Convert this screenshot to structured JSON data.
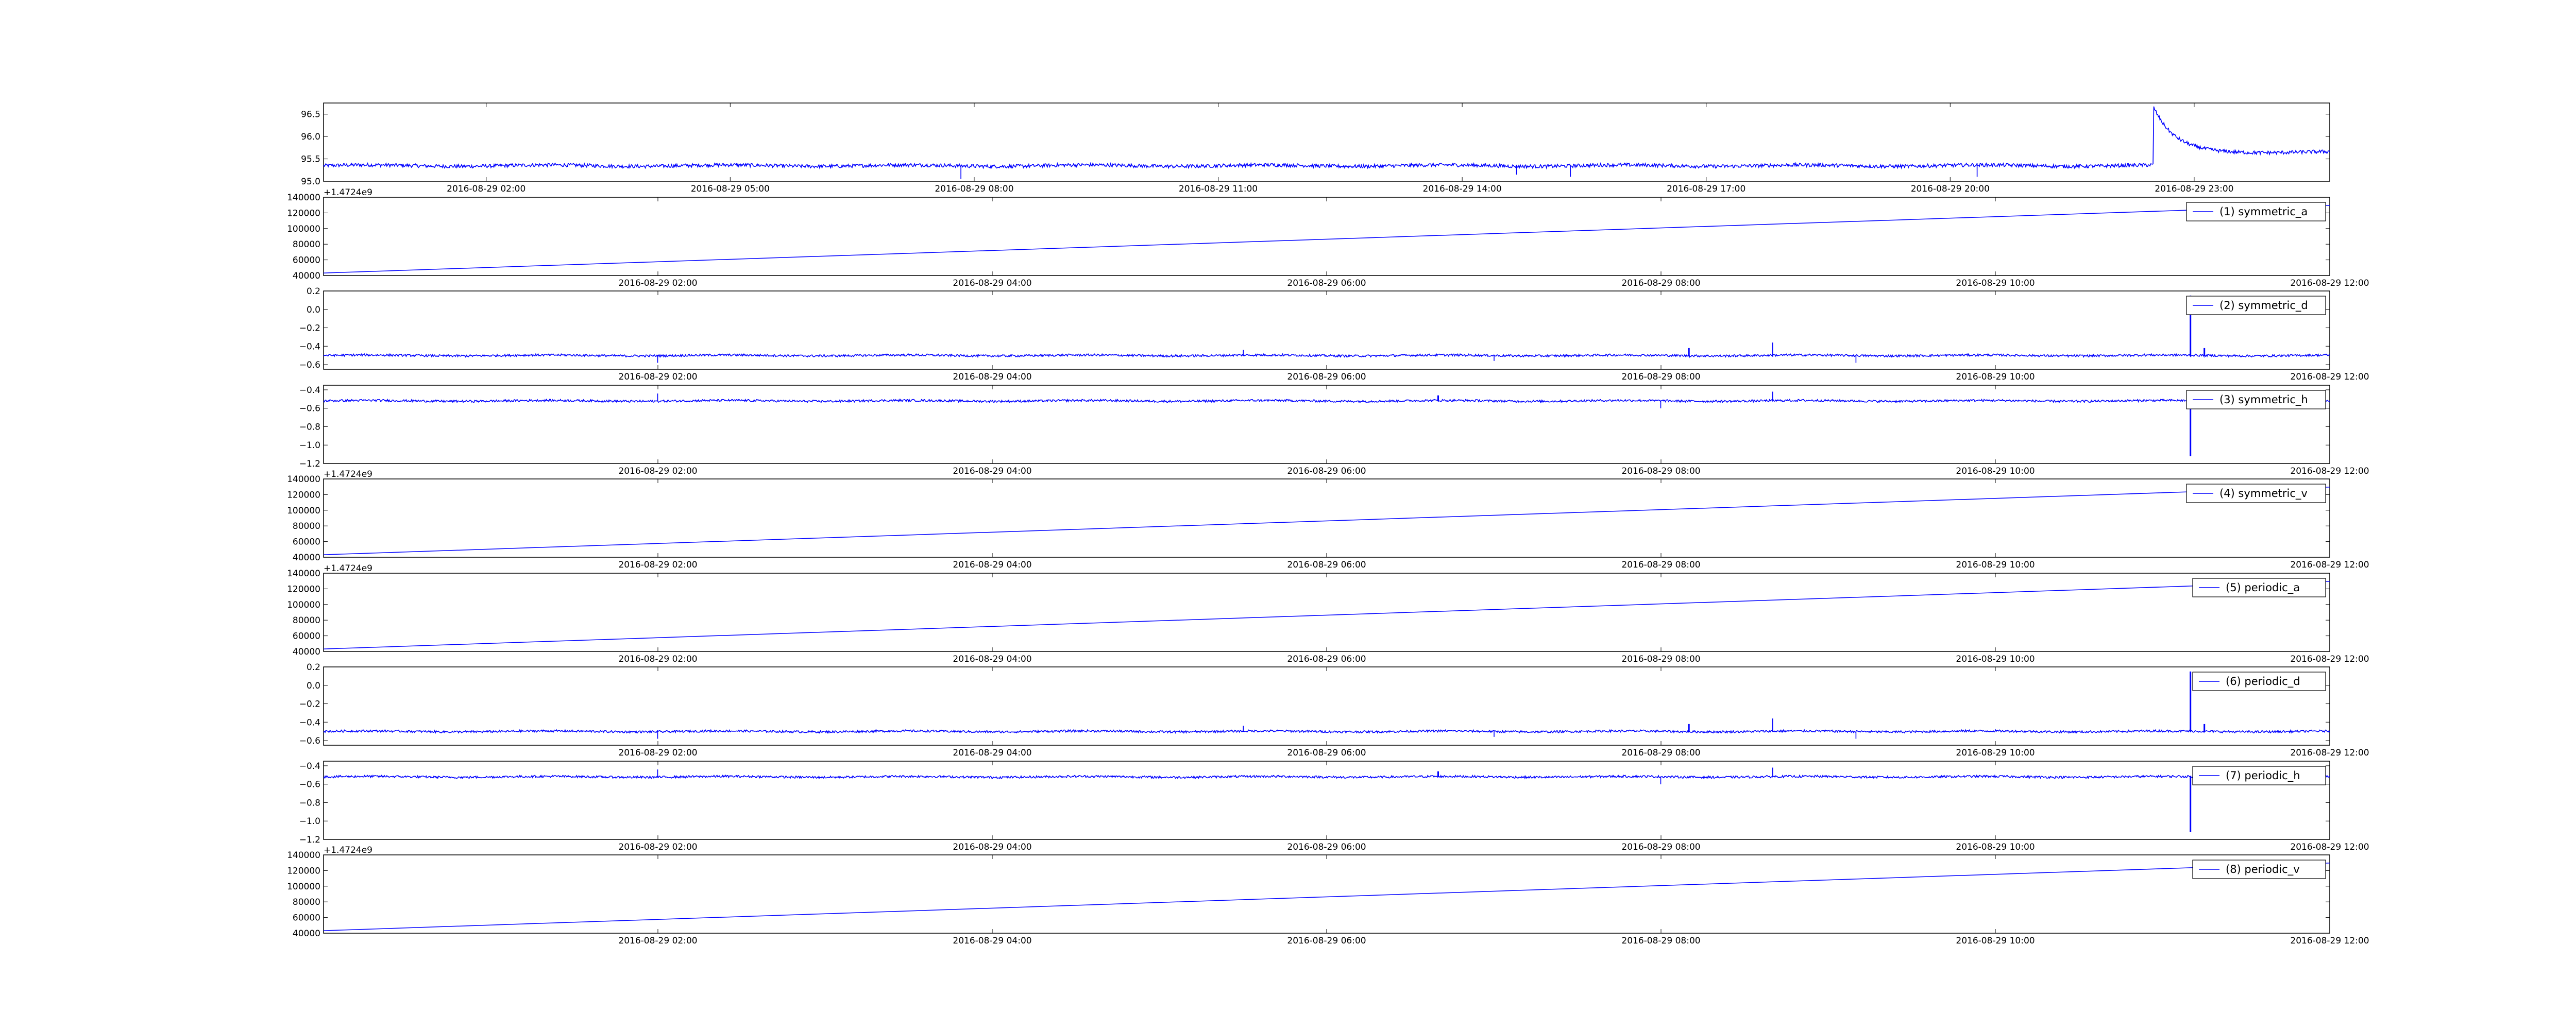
{
  "colors": {
    "series": "#0000ff",
    "axes": "#000000",
    "background": "#ffffff"
  },
  "chart_data": [
    {
      "type": "line",
      "title": "",
      "xlabel": "",
      "ylabel": "",
      "legend": "",
      "offset_label": "",
      "x_range": [
        "2016-08-29 00:00",
        "2016-08-30 00:40"
      ],
      "xticks": [
        "2016-08-29 02:00",
        "2016-08-29 05:00",
        "2016-08-29 08:00",
        "2016-08-29 11:00",
        "2016-08-29 14:00",
        "2016-08-29 17:00",
        "2016-08-29 20:00",
        "2016-08-29 23:00"
      ],
      "ylim": [
        95.0,
        96.75
      ],
      "yticks": [
        "95.0",
        "95.5",
        "96.0",
        "96.5"
      ],
      "pattern": "noise",
      "baseline": 95.35,
      "noise": 0.04,
      "shift_at": "2016-08-29 22:30",
      "shift_level": 95.65,
      "shift_peak": 96.65,
      "spikes": [
        [
          "2016-08-29 07:50",
          95.05
        ],
        [
          "2016-08-29 14:40",
          95.15
        ],
        [
          "2016-08-29 15:20",
          95.1
        ],
        [
          "2016-08-29 20:20",
          95.1
        ]
      ]
    },
    {
      "type": "line",
      "legend": "(1) symmetric_a",
      "offset_label": "+1.4724e9",
      "legend_position": "top-right",
      "x_range": [
        "2016-08-29 00:00",
        "2016-08-29 12:00"
      ],
      "xticks": [
        "2016-08-29 02:00",
        "2016-08-29 04:00",
        "2016-08-29 06:00",
        "2016-08-29 08:00",
        "2016-08-29 10:00",
        "2016-08-29 12:00"
      ],
      "ylim": [
        40000,
        140000
      ],
      "yticks": [
        "40000",
        "60000",
        "80000",
        "100000",
        "120000",
        "140000"
      ],
      "pattern": "linear",
      "x": [
        "2016-08-29 00:00",
        "2016-08-29 12:00"
      ],
      "y": [
        43200,
        129600
      ]
    },
    {
      "type": "line",
      "legend": "(2) symmetric_d",
      "offset_label": "",
      "legend_position": "top-right",
      "x_range": [
        "2016-08-29 00:00",
        "2016-08-29 12:00"
      ],
      "xticks": [
        "2016-08-29 02:00",
        "2016-08-29 04:00",
        "2016-08-29 06:00",
        "2016-08-29 08:00",
        "2016-08-29 10:00",
        "2016-08-29 12:00"
      ],
      "ylim": [
        -0.65,
        0.2
      ],
      "yticks": [
        "−0.6",
        "−0.4",
        "−0.2",
        "0.0",
        "0.2"
      ],
      "pattern": "noise",
      "baseline": -0.5,
      "noise": 0.012,
      "spikes": [
        [
          "2016-08-29 02:00",
          -0.58
        ],
        [
          "2016-08-29 05:30",
          -0.44
        ],
        [
          "2016-08-29 07:00",
          -0.56
        ],
        [
          "2016-08-29 08:10",
          -0.42
        ],
        [
          "2016-08-29 08:40",
          -0.36
        ],
        [
          "2016-08-29 09:10",
          -0.58
        ],
        [
          "2016-08-29 11:10",
          0.15
        ],
        [
          "2016-08-29 11:15",
          -0.42
        ]
      ]
    },
    {
      "type": "line",
      "legend": "(3) symmetric_h",
      "offset_label": "",
      "legend_position": "top-right",
      "x_range": [
        "2016-08-29 00:00",
        "2016-08-29 12:00"
      ],
      "xticks": [
        "2016-08-29 02:00",
        "2016-08-29 04:00",
        "2016-08-29 06:00",
        "2016-08-29 08:00",
        "2016-08-29 10:00",
        "2016-08-29 12:00"
      ],
      "ylim": [
        -1.2,
        -0.35
      ],
      "yticks": [
        "−1.2",
        "−1.0",
        "−0.8",
        "−0.6",
        "−0.4"
      ],
      "pattern": "noise",
      "baseline": -0.52,
      "noise": 0.012,
      "spikes": [
        [
          "2016-08-29 02:00",
          -0.44
        ],
        [
          "2016-08-29 06:40",
          -0.46
        ],
        [
          "2016-08-29 08:00",
          -0.6
        ],
        [
          "2016-08-29 08:40",
          -0.42
        ],
        [
          "2016-08-29 11:10",
          -1.12
        ],
        [
          "2016-08-29 11:15",
          -0.46
        ]
      ]
    },
    {
      "type": "line",
      "legend": "(4) symmetric_v",
      "offset_label": "+1.4724e9",
      "legend_position": "top-right",
      "x_range": [
        "2016-08-29 00:00",
        "2016-08-29 12:00"
      ],
      "xticks": [
        "2016-08-29 02:00",
        "2016-08-29 04:00",
        "2016-08-29 06:00",
        "2016-08-29 08:00",
        "2016-08-29 10:00",
        "2016-08-29 12:00"
      ],
      "ylim": [
        40000,
        140000
      ],
      "yticks": [
        "40000",
        "60000",
        "80000",
        "100000",
        "120000",
        "140000"
      ],
      "pattern": "linear",
      "x": [
        "2016-08-29 00:00",
        "2016-08-29 12:00"
      ],
      "y": [
        43200,
        129600
      ]
    },
    {
      "type": "line",
      "legend": "(5) periodic_a",
      "offset_label": "+1.4724e9",
      "legend_position": "top-right",
      "x_range": [
        "2016-08-29 00:00",
        "2016-08-29 12:00"
      ],
      "xticks": [
        "2016-08-29 02:00",
        "2016-08-29 04:00",
        "2016-08-29 06:00",
        "2016-08-29 08:00",
        "2016-08-29 10:00",
        "2016-08-29 12:00"
      ],
      "ylim": [
        40000,
        140000
      ],
      "yticks": [
        "40000",
        "60000",
        "80000",
        "100000",
        "120000",
        "140000"
      ],
      "pattern": "linear",
      "x": [
        "2016-08-29 00:00",
        "2016-08-29 12:00"
      ],
      "y": [
        43200,
        129600
      ]
    },
    {
      "type": "line",
      "legend": "(6) periodic_d",
      "offset_label": "",
      "legend_position": "top-right",
      "x_range": [
        "2016-08-29 00:00",
        "2016-08-29 12:00"
      ],
      "xticks": [
        "2016-08-29 02:00",
        "2016-08-29 04:00",
        "2016-08-29 06:00",
        "2016-08-29 08:00",
        "2016-08-29 10:00",
        "2016-08-29 12:00"
      ],
      "ylim": [
        -0.65,
        0.2
      ],
      "yticks": [
        "−0.6",
        "−0.4",
        "−0.2",
        "0.0",
        "0.2"
      ],
      "pattern": "noise",
      "baseline": -0.5,
      "noise": 0.012,
      "spikes": [
        [
          "2016-08-29 02:00",
          -0.58
        ],
        [
          "2016-08-29 05:30",
          -0.44
        ],
        [
          "2016-08-29 07:00",
          -0.56
        ],
        [
          "2016-08-29 08:10",
          -0.42
        ],
        [
          "2016-08-29 08:40",
          -0.36
        ],
        [
          "2016-08-29 09:10",
          -0.58
        ],
        [
          "2016-08-29 11:10",
          0.15
        ],
        [
          "2016-08-29 11:15",
          -0.42
        ]
      ]
    },
    {
      "type": "line",
      "legend": "(7) periodic_h",
      "offset_label": "",
      "legend_position": "top-right",
      "x_range": [
        "2016-08-29 00:00",
        "2016-08-29 12:00"
      ],
      "xticks": [
        "2016-08-29 02:00",
        "2016-08-29 04:00",
        "2016-08-29 06:00",
        "2016-08-29 08:00",
        "2016-08-29 10:00",
        "2016-08-29 12:00"
      ],
      "ylim": [
        -1.2,
        -0.35
      ],
      "yticks": [
        "−1.2",
        "−1.0",
        "−0.8",
        "−0.6",
        "−0.4"
      ],
      "pattern": "noise",
      "baseline": -0.52,
      "noise": 0.012,
      "spikes": [
        [
          "2016-08-29 02:00",
          -0.44
        ],
        [
          "2016-08-29 06:40",
          -0.46
        ],
        [
          "2016-08-29 08:00",
          -0.6
        ],
        [
          "2016-08-29 08:40",
          -0.42
        ],
        [
          "2016-08-29 11:10",
          -1.12
        ],
        [
          "2016-08-29 11:15",
          -0.46
        ]
      ]
    },
    {
      "type": "line",
      "legend": "(8) periodic_v",
      "offset_label": "+1.4724e9",
      "legend_position": "top-right",
      "x_range": [
        "2016-08-29 00:00",
        "2016-08-29 12:00"
      ],
      "xticks": [
        "2016-08-29 02:00",
        "2016-08-29 04:00",
        "2016-08-29 06:00",
        "2016-08-29 08:00",
        "2016-08-29 10:00",
        "2016-08-29 12:00"
      ],
      "ylim": [
        40000,
        140000
      ],
      "yticks": [
        "40000",
        "60000",
        "80000",
        "100000",
        "120000",
        "140000"
      ],
      "pattern": "linear",
      "x": [
        "2016-08-29 00:00",
        "2016-08-29 12:00"
      ],
      "y": [
        43200,
        129600
      ]
    }
  ]
}
